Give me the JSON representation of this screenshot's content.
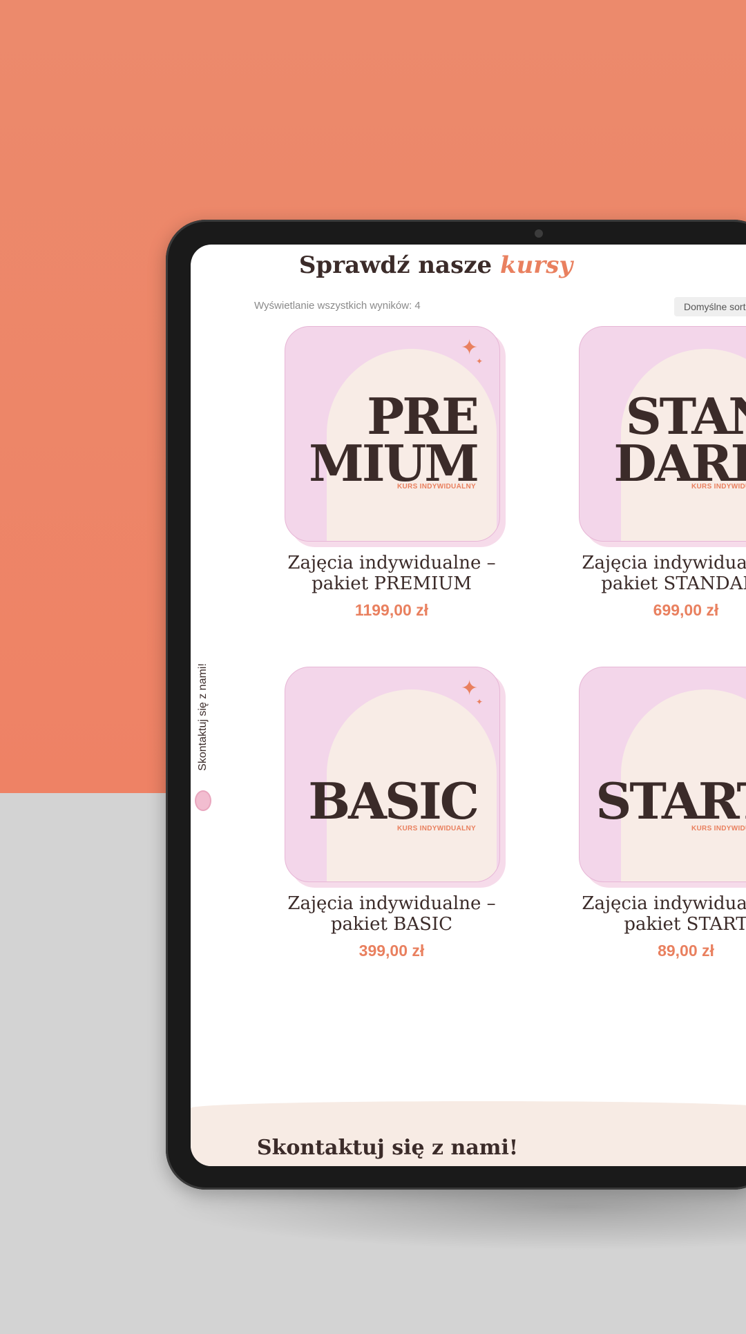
{
  "page": {
    "title_main": "Sprawdź nasze",
    "title_accent": "kursy",
    "result_count": "Wyświetlanie wszystkich wyników: 4",
    "sort_label": "Domyślne sortowanie",
    "contact_tab": "Skontaktuj się z nami!",
    "footer_title": "Skontaktuj się z nami!"
  },
  "products": [
    {
      "image_lines": [
        "PRE",
        "MIUM"
      ],
      "image_caption": "KURS INDYWIDUALNY",
      "title_line1": "Zajęcia indywidualne –",
      "title_line2": "pakiet PREMIUM",
      "price": "1199,00 zł"
    },
    {
      "image_lines": [
        "STAN",
        "DARD"
      ],
      "image_caption": "KURS INDYWIDUALNY",
      "title_line1": "Zajęcia indywidualne –",
      "title_line2": "pakiet STANDARD",
      "price": "699,00 zł"
    },
    {
      "image_lines": [
        "BASIC"
      ],
      "image_caption": "KURS INDYWIDUALNY",
      "title_line1": "Zajęcia indywidualne –",
      "title_line2": "pakiet BASIC",
      "price": "399,00 zł"
    },
    {
      "image_lines": [
        "START"
      ],
      "image_caption": "KURS INDYWIDUALNY",
      "title_line1": "Zajęcia indywidualne –",
      "title_line2": "pakiet START",
      "price": "89,00 zł"
    }
  ],
  "colors": {
    "accent": "#e9805f",
    "text_dark": "#3b2b29",
    "card_pink": "#f3d6ea",
    "arch_cream": "#f8ece6",
    "background_orange": "#ec8a6c",
    "background_grey": "#d3d3d3"
  },
  "icons": [
    "sparkle-icon",
    "chat-bubble-icon",
    "camera-icon"
  ]
}
